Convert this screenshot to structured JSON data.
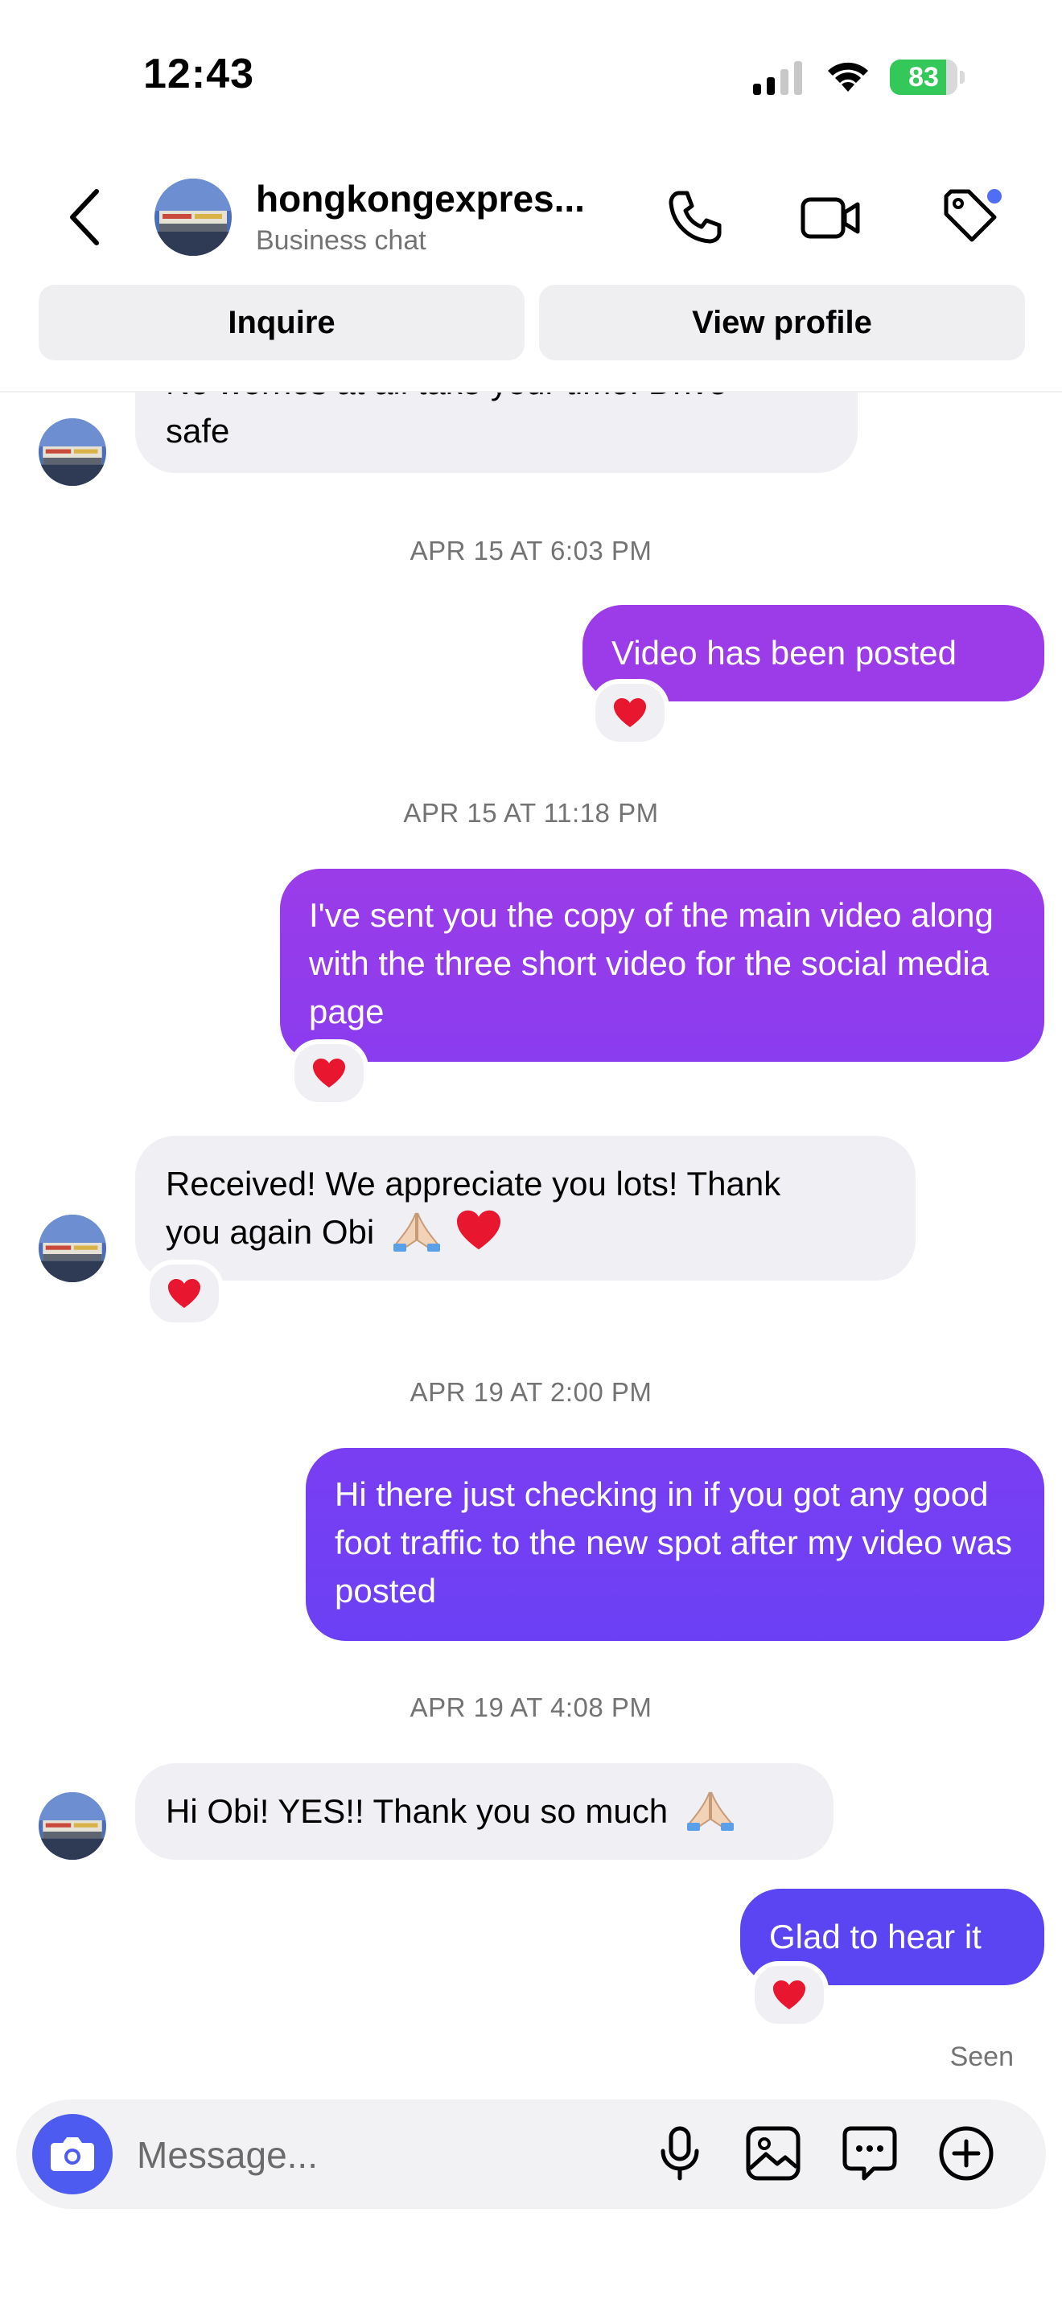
{
  "status_bar": {
    "time": "12:43",
    "battery": "83"
  },
  "header": {
    "title": "hongkongexpres...",
    "subtitle": "Business chat",
    "inquire_label": "Inquire",
    "view_profile_label": "View profile"
  },
  "messages": [
    {
      "dir": "in",
      "text_line1": "No worries at all take your time! Drive",
      "text_line2": "safe"
    },
    {
      "timestamp": "APR 15 AT 6:03 PM"
    },
    {
      "dir": "out",
      "text": "Video has been posted",
      "reaction": "heart"
    },
    {
      "timestamp": "APR 15 AT 11:18 PM"
    },
    {
      "dir": "out",
      "text": "I've sent you the copy of the main video along with the three short video for the social media page",
      "reaction": "heart"
    },
    {
      "dir": "in",
      "text_line1": "Received! We appreciate you lots! Thank",
      "text_line2": "you again Obi",
      "reaction": "heart"
    },
    {
      "timestamp": "APR 19 AT 2:00 PM"
    },
    {
      "dir": "out",
      "text": "Hi there just checking in if you got any good foot traffic to the new spot after my video was posted"
    },
    {
      "timestamp": "APR 19 AT 4:08 PM"
    },
    {
      "dir": "in",
      "text": "Hi Obi! YES!! Thank you so much"
    },
    {
      "dir": "out",
      "text": "Glad to hear it",
      "reaction": "heart"
    }
  ],
  "seen_label": "Seen",
  "composer": {
    "placeholder": "Message..."
  },
  "colors": {
    "outgoing_purple": "#9b3ce8",
    "outgoing_violet": "#6e3ff4",
    "incoming_gray": "#efeff4",
    "camera_button": "#4d5bf0",
    "battery_green": "#34c759",
    "notification_dot": "#4f6ef7"
  },
  "icons": [
    "back-chevron-icon",
    "phone-icon",
    "video-camera-icon",
    "tag-icon",
    "camera-icon",
    "microphone-icon",
    "gallery-icon",
    "sticker-icon",
    "plus-circle-icon",
    "heart-icon",
    "praying-hands-icon"
  ]
}
